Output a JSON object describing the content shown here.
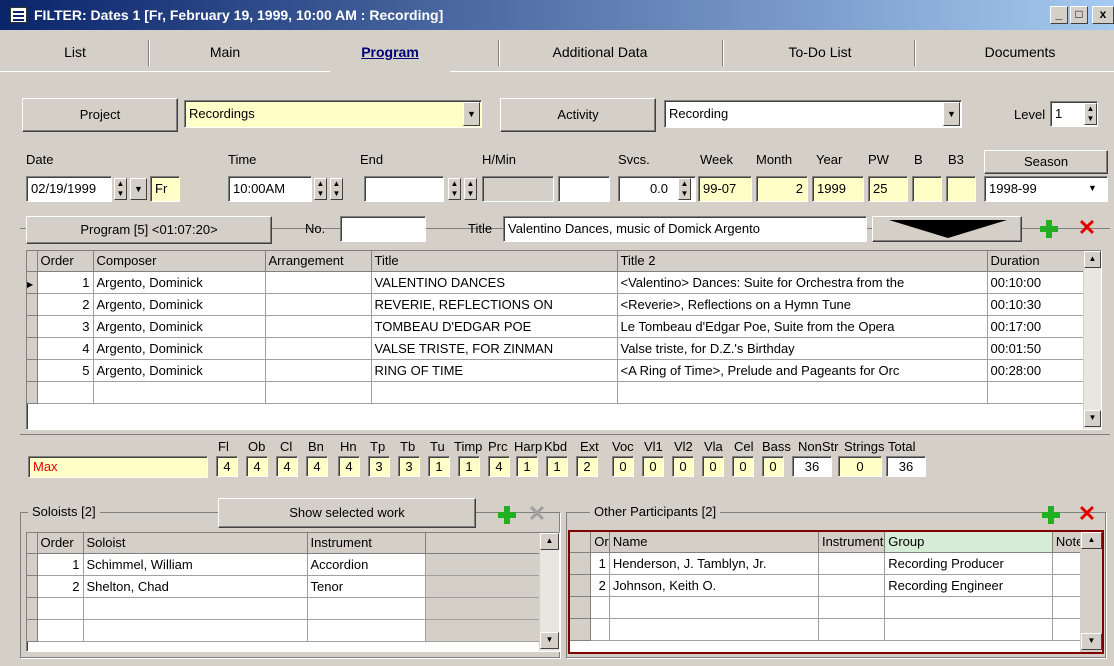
{
  "window": {
    "title": "FILTER: Dates  1 [Fr, February  19, 1999, 10:00 AM : Recording]",
    "min": "_",
    "max": "□",
    "close": "x"
  },
  "tabs": [
    "List",
    "Main",
    "Program",
    "Additional Data",
    "To-Do List",
    "Documents"
  ],
  "header": {
    "project_label": "Project",
    "project_value": "Recordings",
    "activity_label": "Activity",
    "activity_value": "Recording",
    "level_label": "Level",
    "level_value": "1"
  },
  "date_row": {
    "labels": {
      "date": "Date",
      "time": "Time",
      "end": "End",
      "hmin": "H/Min",
      "svcs": "Svcs.",
      "week": "Week",
      "month": "Month",
      "year": "Year",
      "pw": "PW",
      "b": "B",
      "b3": "B3",
      "season": "Season"
    },
    "date": "02/19/1999",
    "day": "Fr",
    "time": "10:00AM",
    "end": "",
    "hmin": "",
    "svcs": "0.0",
    "week": "99-07",
    "month": "2",
    "year": "1999",
    "pw": "25",
    "b": "",
    "b3": "",
    "season": "1998-99"
  },
  "program_bar": {
    "program_label": "Program  [5]  <01:07:20>",
    "no_label": "No.",
    "no_value": "",
    "title_label": "Title",
    "title_value": "Valentino Dances, music of Domick Argento"
  },
  "program_table": {
    "headers": [
      "Order",
      "Composer",
      "Arrangement",
      "Title",
      "Title 2",
      "Duration"
    ],
    "rows": [
      [
        "1",
        "Argento, Dominick",
        "",
        "VALENTINO DANCES",
        "<Valentino> Dances:  Suite for Orchestra from the",
        "00:10:00"
      ],
      [
        "2",
        "Argento, Dominick",
        "",
        "REVERIE, REFLECTIONS ON",
        "<Reverie>, Reflections on a Hymn Tune",
        "00:10:30"
      ],
      [
        "3",
        "Argento, Dominick",
        "",
        "TOMBEAU D'EDGAR POE",
        "Le Tombeau d'Edgar Poe, Suite from the Opera",
        "00:17:00"
      ],
      [
        "4",
        "Argento, Dominick",
        "",
        "VALSE TRISTE, FOR ZINMAN",
        "Valse triste, for D.Z.'s Birthday",
        "00:01:50"
      ],
      [
        "5",
        "Argento, Dominick",
        "",
        "RING OF TIME",
        "<A Ring of Time>, Prelude and Pageants for Orc",
        "00:28:00"
      ]
    ]
  },
  "instrumentation": {
    "row_label": "Max",
    "headers": [
      "Fl",
      "Ob",
      "Cl",
      "Bn",
      "Hn",
      "Tp",
      "Tb",
      "Tu",
      "Timp",
      "Prc",
      "Harp",
      "Kbd",
      "Ext",
      "Voc",
      "Vl1",
      "Vl2",
      "Vla",
      "Cel",
      "Bass",
      "NonStr",
      "Strings",
      "Total"
    ],
    "values": [
      "4",
      "4",
      "4",
      "4",
      "4",
      "3",
      "3",
      "1",
      "1",
      "4",
      "1",
      "1",
      "2",
      "0",
      "0",
      "0",
      "0",
      "0",
      "0",
      "36",
      "0",
      "36"
    ]
  },
  "soloists": {
    "label": "Soloists  [2]",
    "show_button": "Show selected work",
    "headers": [
      "Order",
      "Soloist",
      "Instrument"
    ],
    "rows": [
      [
        "1",
        "Schimmel, William",
        "Accordion"
      ],
      [
        "2",
        "Shelton, Chad",
        "Tenor"
      ]
    ]
  },
  "participants": {
    "label": "Other Participants  [2]",
    "headers": [
      "Order",
      "Name",
      "Instrument",
      "Group",
      "Notes"
    ],
    "rows": [
      [
        "1",
        "Henderson, J. Tamblyn, Jr.",
        "",
        "Recording Producer",
        ""
      ],
      [
        "2",
        "Johnson, Keith O.",
        "",
        "Recording Engineer",
        ""
      ]
    ]
  },
  "colors": {
    "accent_red": "#e00000",
    "plus_green": "#21b021",
    "field_yellow": "#ffffc8",
    "title_blue": "#0a246a"
  }
}
